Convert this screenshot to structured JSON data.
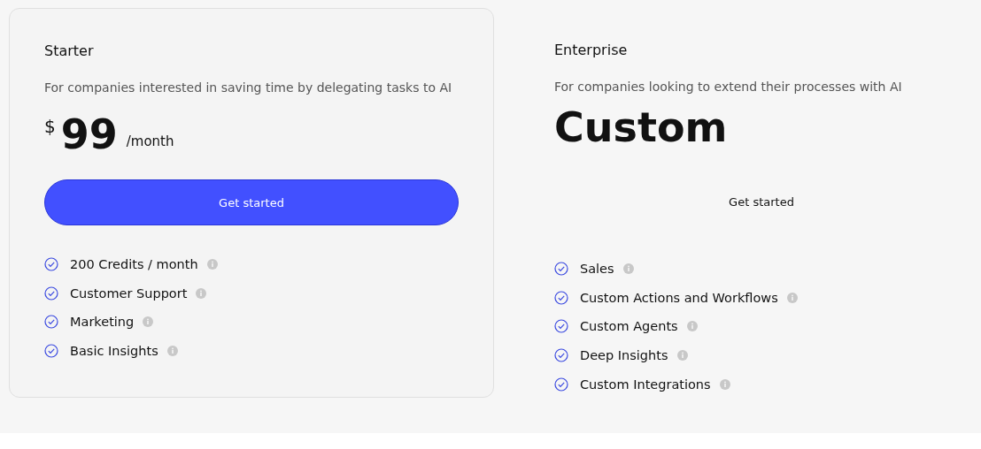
{
  "plans": [
    {
      "name": "Starter",
      "highlighted": true,
      "description": "For companies interested in saving time by delegating tasks to AI",
      "price": {
        "kind": "amount",
        "currency": "$",
        "amount": "99",
        "period": "/month"
      },
      "button": "Get started",
      "features": [
        "200 Credits / month",
        "Customer Support",
        "Marketing",
        "Basic Insights"
      ]
    },
    {
      "name": "Enterprise",
      "highlighted": false,
      "description": "For companies looking to extend their processes with AI",
      "price": {
        "kind": "custom",
        "amount": "Custom"
      },
      "button": "Get started",
      "features": [
        "Sales",
        "Custom Actions and Workflows",
        "Custom Agents",
        "Deep Insights",
        "Custom Integrations"
      ]
    }
  ]
}
